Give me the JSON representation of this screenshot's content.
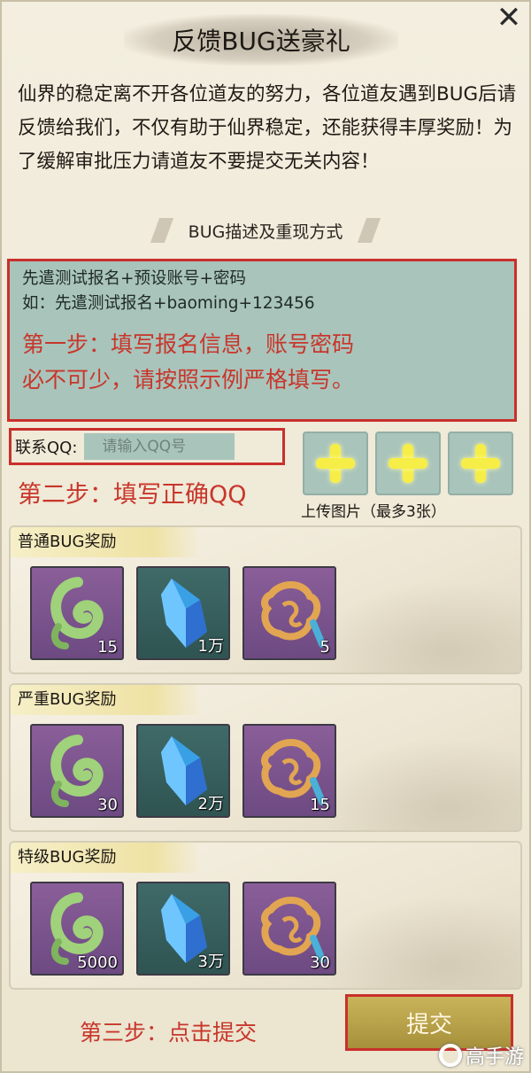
{
  "dialog": {
    "title": "反馈BUG送豪礼",
    "close_glyph": "✕",
    "intro": "仙界的稳定离不开各位道友的努力，各位道友遇到BUG后请反馈给我们，不仅有助于仙界稳定，还能获得丰厚奖励！为了缓解审批压力请道友不要提交无关内容！"
  },
  "description": {
    "heading": "BUG描述及重现方式",
    "line1": "先遣测试报名+预设账号+密码",
    "line2": "如：先遣测试报名+baoming+123456",
    "step1_line1": "第一步：填写报名信息，账号密码",
    "step1_line2": "必不可少，请按照示例严格填写。"
  },
  "contact": {
    "label": "联系QQ:",
    "placeholder": "请输入QQ号"
  },
  "step2": "第二步：填写正确QQ",
  "upload": {
    "label": "上传图片（最多3张）",
    "slots": 3
  },
  "rewards": [
    {
      "title": "普通BUG奖励",
      "items": [
        {
          "icon": "jade-ring-icon",
          "qty": "15"
        },
        {
          "icon": "blue-crystal-icon",
          "qty": "1万"
        },
        {
          "icon": "gold-token-icon",
          "qty": "5"
        }
      ]
    },
    {
      "title": "严重BUG奖励",
      "items": [
        {
          "icon": "jade-ring-icon",
          "qty": "30"
        },
        {
          "icon": "blue-crystal-icon",
          "qty": "2万"
        },
        {
          "icon": "gold-token-icon",
          "qty": "15"
        }
      ]
    },
    {
      "title": "特级BUG奖励",
      "items": [
        {
          "icon": "jade-ring-icon",
          "qty": "5000"
        },
        {
          "icon": "blue-crystal-icon",
          "qty": "3万"
        },
        {
          "icon": "gold-token-icon",
          "qty": "30"
        }
      ]
    }
  ],
  "step3": "第三步：点击提交",
  "submit_label": "提交",
  "watermark": "高手游",
  "colors": {
    "accent_red": "#c9302c",
    "input_teal": "#a9c4bb",
    "item_purple": "#7a5490",
    "plus_yellow": "#f6ee47"
  }
}
